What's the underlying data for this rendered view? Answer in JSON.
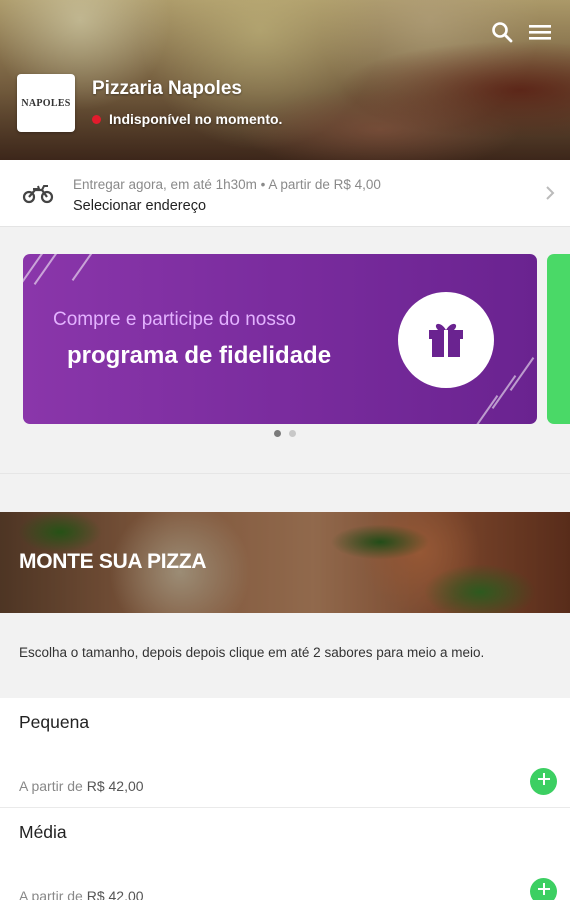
{
  "header": {
    "store_name": "Pizzaria Napoles",
    "status_text": "Indisponível no momento.",
    "logo_text": "NAPOLES",
    "status_color": "#e21b2d",
    "icons": [
      "search-icon",
      "menu-icon"
    ]
  },
  "delivery": {
    "line1": "Entregar agora, em até 1h30m • A partir de R$ 4,00",
    "select_address": "Selecionar endereço",
    "icon": "motorcycle-icon"
  },
  "banner": {
    "line1": "Compre e participe do nosso",
    "line2": "programa de fidelidade",
    "icon": "gift-icon",
    "bg_color": "#7a2c9e",
    "next_banner_color": "#4ad967",
    "page_count": 2,
    "active_page": 1
  },
  "pizza_section": {
    "title": "MONTE SUA PIZZA",
    "description": "Escolha o tamanho, depois depois clique em até 2 sabores para meio a meio."
  },
  "sizes": [
    {
      "name": "Pequena",
      "price_prefix": "A partir de",
      "price": "R$ 42,00"
    },
    {
      "name": "Média",
      "price_prefix": "A partir de",
      "price": "R$ 42,00"
    }
  ],
  "colors": {
    "accent_green": "#3ccf62"
  }
}
